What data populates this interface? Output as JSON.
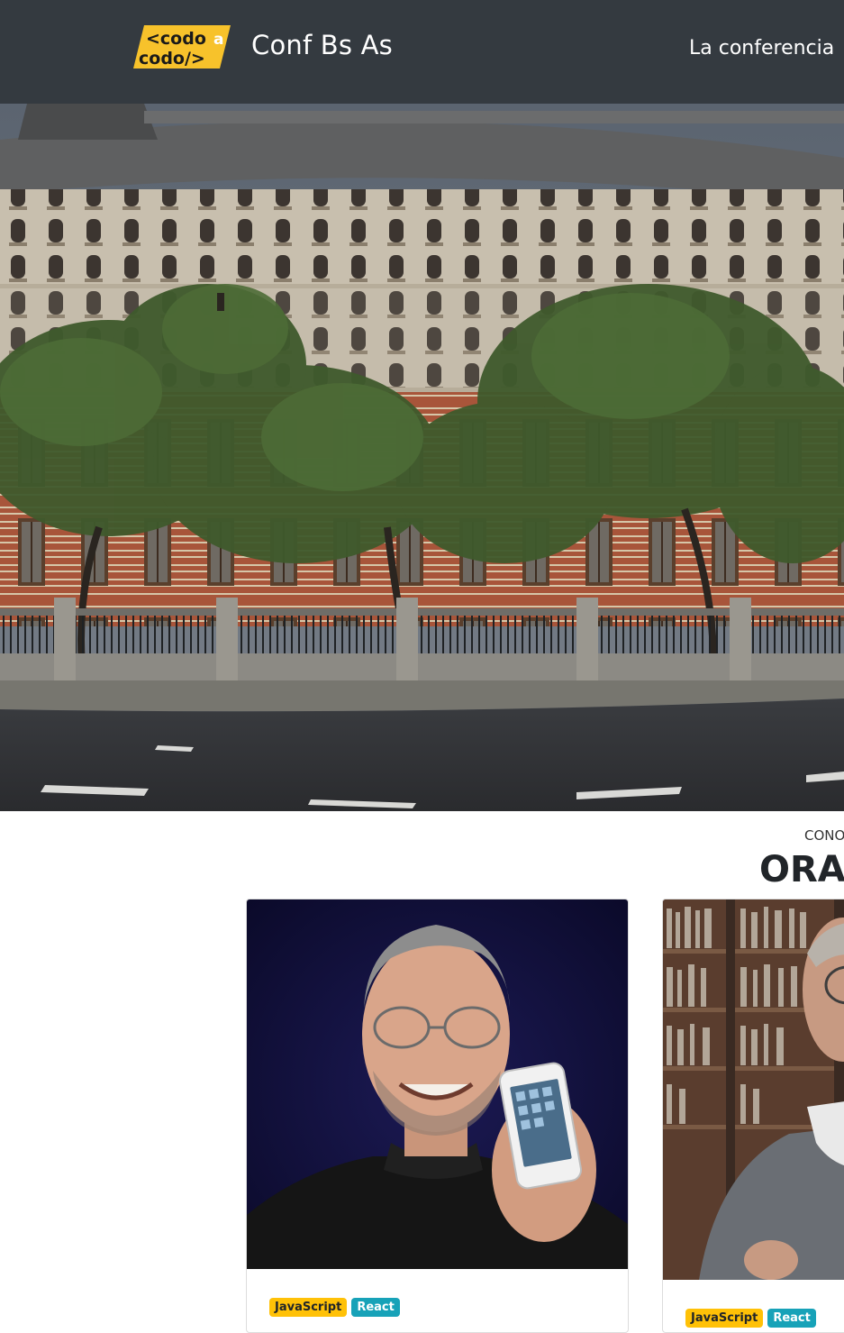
{
  "navbar": {
    "logo": {
      "line1": "<codo",
      "line1_suffix": "a",
      "line2": "codo/>"
    },
    "brand_title": "Conf Bs As",
    "links": [
      {
        "label": "La conferencia"
      }
    ]
  },
  "speakers_section": {
    "eyebrow": "CONO",
    "title": "ORAD",
    "cards": [
      {
        "badges": [
          "JavaScript",
          "React"
        ]
      },
      {
        "badges": [
          "JavaScript",
          "React"
        ]
      }
    ]
  },
  "colors": {
    "navbar_bg": "#343a40",
    "logo_yellow": "#f7c22b",
    "badge_js": "#ffc107",
    "badge_react": "#17a2b8"
  },
  "icons": {
    "logo": "codo-a-codo-logo",
    "hero": "building-photo",
    "speaker1": "speaker-photo",
    "speaker2": "speaker-photo"
  }
}
